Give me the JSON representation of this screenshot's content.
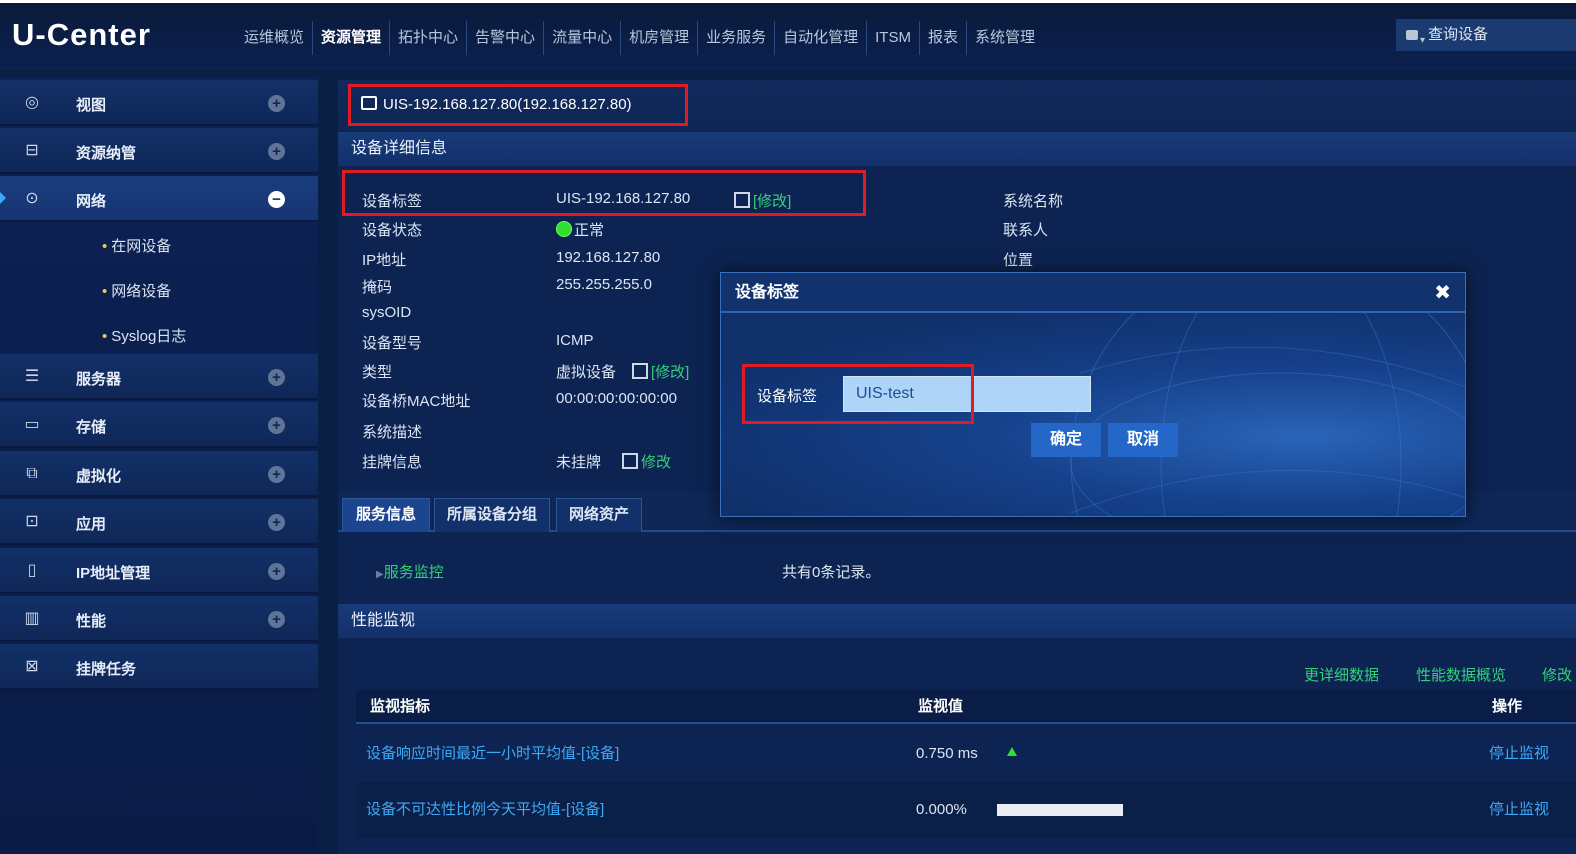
{
  "app": {
    "logo": "U-Center"
  },
  "nav": [
    "运维概览",
    "资源管理",
    "拓扑中心",
    "告警中心",
    "流量中心",
    "机房管理",
    "业务服务",
    "自动化管理",
    "ITSM",
    "报表",
    "系统管理"
  ],
  "query_button": "查询设备",
  "sidebar": {
    "items": [
      {
        "label": "视图",
        "icon": "eye-icon"
      },
      {
        "label": "资源纳管",
        "icon": "briefcase-icon"
      },
      {
        "label": "网络",
        "icon": "network-icon"
      },
      {
        "label": "服务器",
        "icon": "server-icon"
      },
      {
        "label": "存储",
        "icon": "storage-icon"
      },
      {
        "label": "虚拟化",
        "icon": "virtualization-icon"
      },
      {
        "label": "应用",
        "icon": "application-icon"
      },
      {
        "label": "IP地址管理",
        "icon": "ip-management-icon"
      },
      {
        "label": "性能",
        "icon": "performance-icon"
      },
      {
        "label": "挂牌任务",
        "icon": "tagging-task-icon"
      }
    ],
    "network_sub": [
      "在网设备",
      "网络设备",
      "Syslog日志"
    ]
  },
  "device_title": "UIS-192.168.127.80(192.168.127.80)",
  "detail": {
    "section_title": "设备详细信息",
    "rows": [
      {
        "label": "设备标签",
        "value": "UIS-192.168.127.80"
      },
      {
        "label": "设备状态",
        "value": "正常"
      },
      {
        "label": "IP地址",
        "value": "192.168.127.80"
      },
      {
        "label": "掩码",
        "value": "255.255.255.0"
      },
      {
        "label": "sysOID",
        "value": ""
      },
      {
        "label": "设备型号",
        "value": "ICMP"
      },
      {
        "label": "类型",
        "value": "虚拟设备"
      },
      {
        "label": "设备桥MAC地址",
        "value": "00:00:00:00:00:00"
      },
      {
        "label": "系统描述",
        "value": ""
      },
      {
        "label": "挂牌信息",
        "value": "未挂牌"
      }
    ],
    "modify_bracket": "[修改]",
    "modify_plain": "修改",
    "right_labels": [
      "系统名称",
      "联系人",
      "位置"
    ]
  },
  "tabs": [
    "服务信息",
    "所属设备分组",
    "网络资产"
  ],
  "service": {
    "link": "服务监控",
    "count_text": "共有0条记录。"
  },
  "perf": {
    "section_title": "性能监视",
    "links": [
      "更详细数据",
      "性能数据概览",
      "修改"
    ],
    "columns": [
      "监视指标",
      "监视值",
      "操作"
    ],
    "rows": [
      {
        "metric": "设备响应时间最近一小时平均值-[设备]",
        "value": "0.750 ms",
        "action": "停止监视"
      },
      {
        "metric": "设备不可达性比例今天平均值-[设备]",
        "value": "0.000%",
        "action": "停止监视",
        "bar_fraction": 0.0
      }
    ]
  },
  "modal": {
    "title": "设备标签",
    "field_label": "设备标签",
    "input_value": "UIS-test",
    "confirm": "确定",
    "cancel": "取消"
  },
  "colors": {
    "highlight": "#e11b22",
    "link_green": "#33d07a",
    "link_blue": "#3fa9f5",
    "status_green": "#2fe02f"
  }
}
